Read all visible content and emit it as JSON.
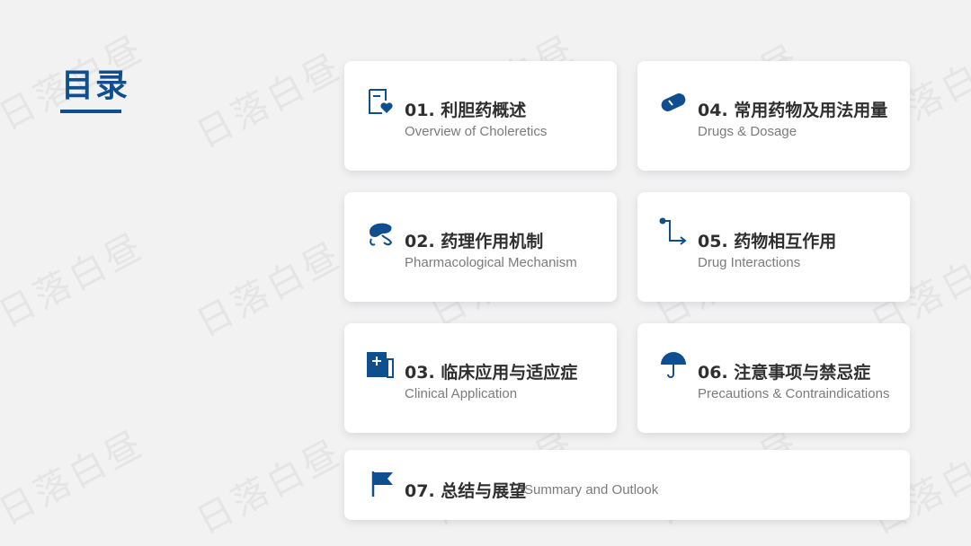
{
  "page": {
    "title": "目录",
    "watermark": "日落白昼",
    "accent_color": "#0f4e8f"
  },
  "items": [
    {
      "num_title": "01. 利胆药概述",
      "subtitle": "Overview of Choleretics",
      "icon": "document-heart-icon"
    },
    {
      "num_title": "04. 常用药物及用法用量",
      "subtitle": "Drugs & Dosage",
      "icon": "pill-icon"
    },
    {
      "num_title": "02. 药理作用机制",
      "subtitle": "Pharmacological Mechanism",
      "icon": "liver-icon"
    },
    {
      "num_title": "05. 药物相互作用",
      "subtitle": "Drug Interactions",
      "icon": "connection-arrow-icon"
    },
    {
      "num_title": "03. 临床应用与适应症",
      "subtitle": "Clinical Application",
      "icon": "medical-document-icon"
    },
    {
      "num_title": "06. 注意事项与禁忌症",
      "subtitle": "Precautions & Contraindications",
      "icon": "umbrella-icon"
    },
    {
      "num_title": "07. 总结与展望",
      "subtitle": "Summary and Outlook",
      "icon": "flag-icon"
    }
  ]
}
